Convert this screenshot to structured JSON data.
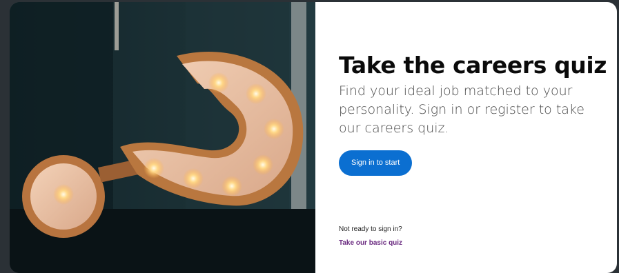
{
  "hero": {
    "image_icon": "question-mark-marquee-lights-photo"
  },
  "quiz_card": {
    "title": "Take the careers quiz",
    "description": "Find your ideal job matched to your personality. Sign in or register to take our careers quiz.",
    "sign_in_label": "Sign in to start",
    "not_ready_text": "Not ready to sign in?",
    "basic_quiz_link": "Take our basic quiz"
  },
  "colors": {
    "page_background": "#2b3136",
    "button": "#0b6fd1",
    "link": "#6a2a80",
    "title": "#0a0a0a"
  }
}
